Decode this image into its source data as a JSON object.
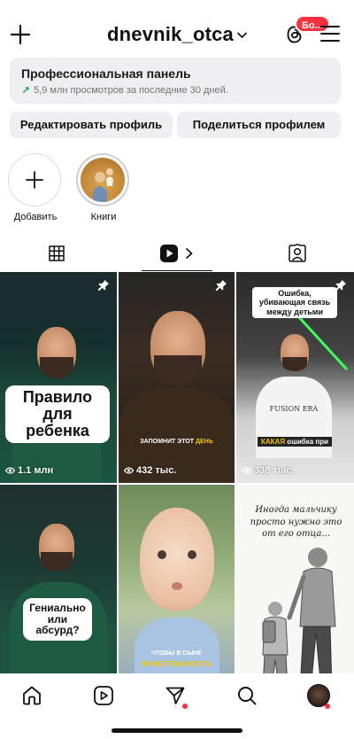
{
  "header": {
    "username": "dnevnik_otca",
    "threads_badge": "Бо..."
  },
  "pro_panel": {
    "title": "Профессиональная панель",
    "subtitle": "5,9 млн просмотров за последние 30 дней."
  },
  "buttons": {
    "edit_profile": "Редактировать профиль",
    "share_profile": "Поделиться профилем"
  },
  "highlights": [
    {
      "label": "Добавить"
    },
    {
      "label": "Книги"
    }
  ],
  "tabs": [
    {
      "name": "grid",
      "icon": "grid-icon",
      "active": false
    },
    {
      "name": "reels",
      "icon": "reels-icon",
      "active": true
    },
    {
      "name": "tagged",
      "icon": "tagged-icon",
      "active": false
    }
  ],
  "reels": [
    {
      "caption": "Правило для ребенка",
      "views": "1.1 млн",
      "pinned": true
    },
    {
      "caption_pre": "ЗАПОМНИТ ЭТОТ ",
      "caption_hl": "ДЕНЬ",
      "views": "432 тыс.",
      "pinned": true
    },
    {
      "caption_top": "Ошибка, убивающая связь между детьми",
      "caption_hl": "КАКАЯ",
      "caption_post": " ошибка при",
      "shirt": "FUSION ERA",
      "views": "338 тыс.",
      "pinned": true
    },
    {
      "caption": "Гениально или абсурд?"
    },
    {
      "caption_pre": "ЧТОБЫ В СЫНЕ",
      "caption_hl": "МУЖЕСТВЕННОСТЬ"
    },
    {
      "caption": "Иногда мальчику просто нужно это от его отца..."
    }
  ],
  "colors": {
    "accent_red": "#ff3040",
    "panel_bg": "#efeff1",
    "caption_yellow": "#f2c400"
  }
}
